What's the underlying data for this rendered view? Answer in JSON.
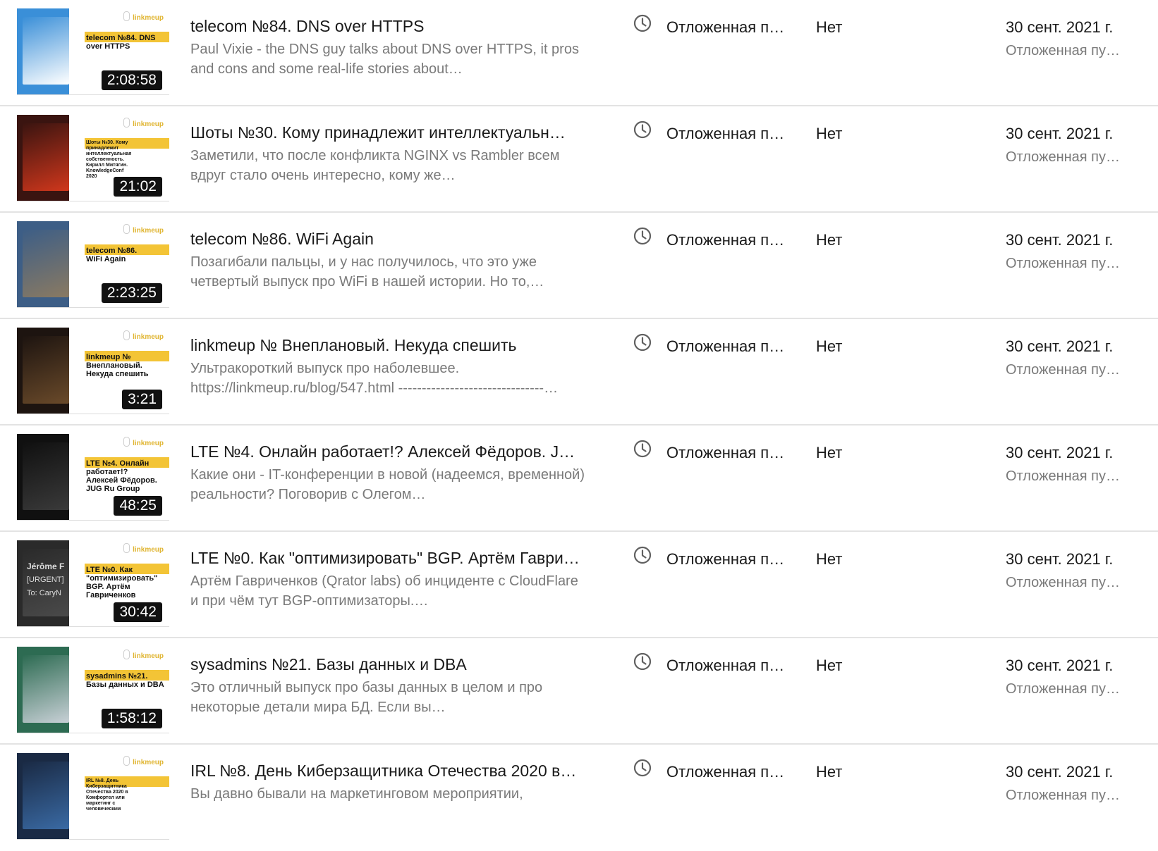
{
  "colors": {
    "accent_yellow": "#f3c436",
    "text_primary": "#1a1a1a",
    "text_secondary": "#7a7a7a",
    "divider": "#e3e3e3"
  },
  "icons": {
    "visibility": "clock-icon",
    "logo": "microphone-icon"
  },
  "videos": [
    {
      "thumb_logo": "linkmeup",
      "thumb_caption": "telecom №84. DNS\nover HTTPS",
      "duration": "2:08:58",
      "title": "telecom №84. DNS over HTTPS",
      "description": "Paul Vixie - the DNS guy talks about DNS over HTTPS, it pros and cons and some real-life stories about…",
      "visibility": "Отложенная п…",
      "restrictions": "Нет",
      "date": "30 сент. 2021 г.",
      "date_status": "Отложенная пу…",
      "thumb_colors": [
        "#3a8fd8",
        "#ffffff"
      ]
    },
    {
      "thumb_logo": "linkmeup",
      "thumb_caption": "Шоты №30. Кому\nпринадлежит\nинтеллектуальная\nсобственность.\nКирилл Митягин.\nKnowledgeConf\n2020",
      "duration": "21:02",
      "title": "Шоты №30. Кому принадлежит интеллектуальн…",
      "description": "Заметили, что после конфликта NGINX vs Rambler всем вдруг стало очень интересно, кому же…",
      "visibility": "Отложенная п…",
      "restrictions": "Нет",
      "date": "30 сент. 2021 г.",
      "date_status": "Отложенная пу…",
      "thumb_colors": [
        "#3a1410",
        "#d0371c"
      ]
    },
    {
      "thumb_logo": "linkmeup",
      "thumb_caption": "telecom №86.\nWiFi Again",
      "duration": "2:23:25",
      "title": "telecom №86. WiFi Again",
      "description": "Позагибали пальцы, и у нас получилось, что это уже четвертый выпуск про WiFi в нашей истории. Но то,…",
      "visibility": "Отложенная п…",
      "restrictions": "Нет",
      "date": "30 сент. 2021 г.",
      "date_status": "Отложенная пу…",
      "thumb_colors": [
        "#3d5e86",
        "#8a7a62"
      ]
    },
    {
      "thumb_logo": "linkmeup",
      "thumb_caption": "linkmeup №\nВнеплановый.\nНекуда спешить",
      "duration": "3:21",
      "title": "linkmeup № Внеплановый. Некуда спешить",
      "description": "Ультракороткий выпуск про наболевшее. https://linkmeup.ru/blog/547.html -------------------------------…",
      "visibility": "Отложенная п…",
      "restrictions": "Нет",
      "date": "30 сент. 2021 г.",
      "date_status": "Отложенная пу…",
      "thumb_colors": [
        "#1d1410",
        "#6a4a2a"
      ]
    },
    {
      "thumb_logo": "linkmeup",
      "thumb_caption": "LTE №4. Онлайн\nработает!?\nАлексей Фёдоров.\nJUG Ru Group",
      "duration": "48:25",
      "title": "LTE №4. Онлайн работает!? Алексей Фёдоров. J…",
      "description": "Какие они - IT-конференции в новой (надеемся, временной) реальности? Поговорив с Олегом…",
      "visibility": "Отложенная п…",
      "restrictions": "Нет",
      "date": "30 сент. 2021 г.",
      "date_status": "Отложенная пу…",
      "thumb_colors": [
        "#101010",
        "#3a3a3a"
      ]
    },
    {
      "thumb_logo": "linkmeup",
      "thumb_caption": "LTE №0. Как\n\"оптимизировать\"\nBGP. Артём\nГавриченков",
      "duration": "30:42",
      "title": "LTE №0. Как \"оптимизировать\" BGP. Артём Гаври…",
      "description": "Артём Гавриченков (Qrator labs) об инциденте с CloudFlare и при чём тут BGP-оптимизаторы.…",
      "visibility": "Отложенная п…",
      "restrictions": "Нет",
      "date": "30 сент. 2021 г.",
      "date_status": "Отложенная пу…",
      "thumb_colors": [
        "#2a2a2a",
        "#4a4a4a"
      ],
      "thumb_overlay": [
        "Jérôme F",
        "[URGENT]",
        "To:  CaryN"
      ]
    },
    {
      "thumb_logo": "linkmeup",
      "thumb_caption": "sysadmins №21.\nБазы данных и DBA",
      "duration": "1:58:12",
      "title": "sysadmins №21. Базы данных и DBA",
      "description": "Это отличный выпуск про базы данных в целом и про некоторые детали мира БД. Если вы…",
      "visibility": "Отложенная п…",
      "restrictions": "Нет",
      "date": "30 сент. 2021 г.",
      "date_status": "Отложенная пу…",
      "thumb_colors": [
        "#2d6b52",
        "#c8d0d6"
      ]
    },
    {
      "thumb_logo": "linkmeup",
      "thumb_caption": "IRL №8. День\nКиберзащитника\nОтечества 2020 в\nКомфортел или\nмаркетинг с\nчеловеческим",
      "duration": "",
      "title": "IRL №8. День Киберзащитника Отечества 2020 в…",
      "description": "Вы давно бывали на маркетинговом мероприятии,",
      "visibility": "Отложенная п…",
      "restrictions": "Нет",
      "date": "30 сент. 2021 г.",
      "date_status": "Отложенная пу…",
      "thumb_colors": [
        "#1a2a44",
        "#3a6aa4"
      ]
    }
  ]
}
